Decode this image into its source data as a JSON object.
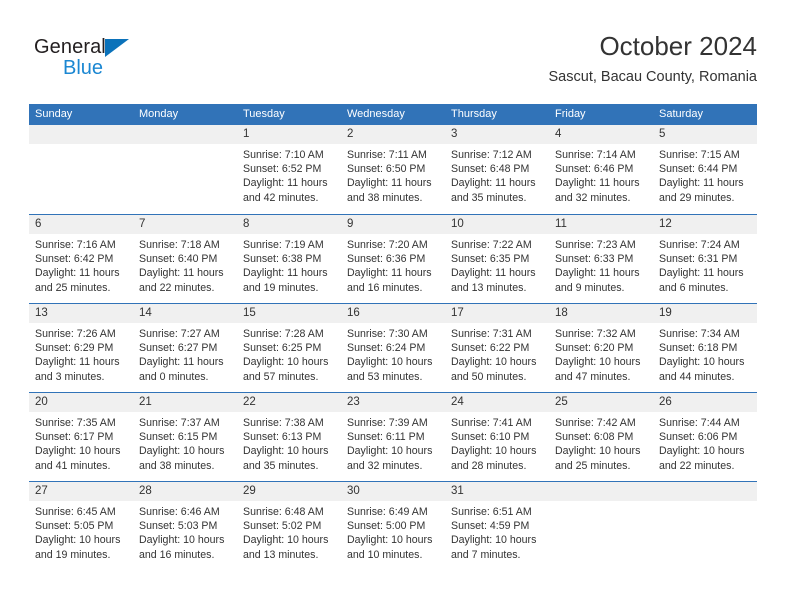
{
  "brand": {
    "name_top": "General",
    "name_bottom": "Blue",
    "triangle_color": "#0b72ba",
    "blue_text_color": "#1b87d2"
  },
  "header": {
    "title": "October 2024",
    "subtitle": "Sascut, Bacau County, Romania"
  },
  "colors": {
    "header_blue": "#3173b8",
    "daynum_band": "#f0f0f0",
    "text": "#333333",
    "row_separator": "#3173b8"
  },
  "weekday_headers": [
    "Sunday",
    "Monday",
    "Tuesday",
    "Wednesday",
    "Thursday",
    "Friday",
    "Saturday"
  ],
  "weeks": [
    [
      {
        "day": "",
        "lines": []
      },
      {
        "day": "",
        "lines": []
      },
      {
        "day": "1",
        "lines": [
          "Sunrise: 7:10 AM",
          "Sunset: 6:52 PM",
          "Daylight: 11 hours",
          "and 42 minutes."
        ]
      },
      {
        "day": "2",
        "lines": [
          "Sunrise: 7:11 AM",
          "Sunset: 6:50 PM",
          "Daylight: 11 hours",
          "and 38 minutes."
        ]
      },
      {
        "day": "3",
        "lines": [
          "Sunrise: 7:12 AM",
          "Sunset: 6:48 PM",
          "Daylight: 11 hours",
          "and 35 minutes."
        ]
      },
      {
        "day": "4",
        "lines": [
          "Sunrise: 7:14 AM",
          "Sunset: 6:46 PM",
          "Daylight: 11 hours",
          "and 32 minutes."
        ]
      },
      {
        "day": "5",
        "lines": [
          "Sunrise: 7:15 AM",
          "Sunset: 6:44 PM",
          "Daylight: 11 hours",
          "and 29 minutes."
        ]
      }
    ],
    [
      {
        "day": "6",
        "lines": [
          "Sunrise: 7:16 AM",
          "Sunset: 6:42 PM",
          "Daylight: 11 hours",
          "and 25 minutes."
        ]
      },
      {
        "day": "7",
        "lines": [
          "Sunrise: 7:18 AM",
          "Sunset: 6:40 PM",
          "Daylight: 11 hours",
          "and 22 minutes."
        ]
      },
      {
        "day": "8",
        "lines": [
          "Sunrise: 7:19 AM",
          "Sunset: 6:38 PM",
          "Daylight: 11 hours",
          "and 19 minutes."
        ]
      },
      {
        "day": "9",
        "lines": [
          "Sunrise: 7:20 AM",
          "Sunset: 6:36 PM",
          "Daylight: 11 hours",
          "and 16 minutes."
        ]
      },
      {
        "day": "10",
        "lines": [
          "Sunrise: 7:22 AM",
          "Sunset: 6:35 PM",
          "Daylight: 11 hours",
          "and 13 minutes."
        ]
      },
      {
        "day": "11",
        "lines": [
          "Sunrise: 7:23 AM",
          "Sunset: 6:33 PM",
          "Daylight: 11 hours",
          "and 9 minutes."
        ]
      },
      {
        "day": "12",
        "lines": [
          "Sunrise: 7:24 AM",
          "Sunset: 6:31 PM",
          "Daylight: 11 hours",
          "and 6 minutes."
        ]
      }
    ],
    [
      {
        "day": "13",
        "lines": [
          "Sunrise: 7:26 AM",
          "Sunset: 6:29 PM",
          "Daylight: 11 hours",
          "and 3 minutes."
        ]
      },
      {
        "day": "14",
        "lines": [
          "Sunrise: 7:27 AM",
          "Sunset: 6:27 PM",
          "Daylight: 11 hours",
          "and 0 minutes."
        ]
      },
      {
        "day": "15",
        "lines": [
          "Sunrise: 7:28 AM",
          "Sunset: 6:25 PM",
          "Daylight: 10 hours",
          "and 57 minutes."
        ]
      },
      {
        "day": "16",
        "lines": [
          "Sunrise: 7:30 AM",
          "Sunset: 6:24 PM",
          "Daylight: 10 hours",
          "and 53 minutes."
        ]
      },
      {
        "day": "17",
        "lines": [
          "Sunrise: 7:31 AM",
          "Sunset: 6:22 PM",
          "Daylight: 10 hours",
          "and 50 minutes."
        ]
      },
      {
        "day": "18",
        "lines": [
          "Sunrise: 7:32 AM",
          "Sunset: 6:20 PM",
          "Daylight: 10 hours",
          "and 47 minutes."
        ]
      },
      {
        "day": "19",
        "lines": [
          "Sunrise: 7:34 AM",
          "Sunset: 6:18 PM",
          "Daylight: 10 hours",
          "and 44 minutes."
        ]
      }
    ],
    [
      {
        "day": "20",
        "lines": [
          "Sunrise: 7:35 AM",
          "Sunset: 6:17 PM",
          "Daylight: 10 hours",
          "and 41 minutes."
        ]
      },
      {
        "day": "21",
        "lines": [
          "Sunrise: 7:37 AM",
          "Sunset: 6:15 PM",
          "Daylight: 10 hours",
          "and 38 minutes."
        ]
      },
      {
        "day": "22",
        "lines": [
          "Sunrise: 7:38 AM",
          "Sunset: 6:13 PM",
          "Daylight: 10 hours",
          "and 35 minutes."
        ]
      },
      {
        "day": "23",
        "lines": [
          "Sunrise: 7:39 AM",
          "Sunset: 6:11 PM",
          "Daylight: 10 hours",
          "and 32 minutes."
        ]
      },
      {
        "day": "24",
        "lines": [
          "Sunrise: 7:41 AM",
          "Sunset: 6:10 PM",
          "Daylight: 10 hours",
          "and 28 minutes."
        ]
      },
      {
        "day": "25",
        "lines": [
          "Sunrise: 7:42 AM",
          "Sunset: 6:08 PM",
          "Daylight: 10 hours",
          "and 25 minutes."
        ]
      },
      {
        "day": "26",
        "lines": [
          "Sunrise: 7:44 AM",
          "Sunset: 6:06 PM",
          "Daylight: 10 hours",
          "and 22 minutes."
        ]
      }
    ],
    [
      {
        "day": "27",
        "lines": [
          "Sunrise: 6:45 AM",
          "Sunset: 5:05 PM",
          "Daylight: 10 hours",
          "and 19 minutes."
        ]
      },
      {
        "day": "28",
        "lines": [
          "Sunrise: 6:46 AM",
          "Sunset: 5:03 PM",
          "Daylight: 10 hours",
          "and 16 minutes."
        ]
      },
      {
        "day": "29",
        "lines": [
          "Sunrise: 6:48 AM",
          "Sunset: 5:02 PM",
          "Daylight: 10 hours",
          "and 13 minutes."
        ]
      },
      {
        "day": "30",
        "lines": [
          "Sunrise: 6:49 AM",
          "Sunset: 5:00 PM",
          "Daylight: 10 hours",
          "and 10 minutes."
        ]
      },
      {
        "day": "31",
        "lines": [
          "Sunrise: 6:51 AM",
          "Sunset: 4:59 PM",
          "Daylight: 10 hours",
          "and 7 minutes."
        ]
      },
      {
        "day": "",
        "lines": []
      },
      {
        "day": "",
        "lines": []
      }
    ]
  ]
}
